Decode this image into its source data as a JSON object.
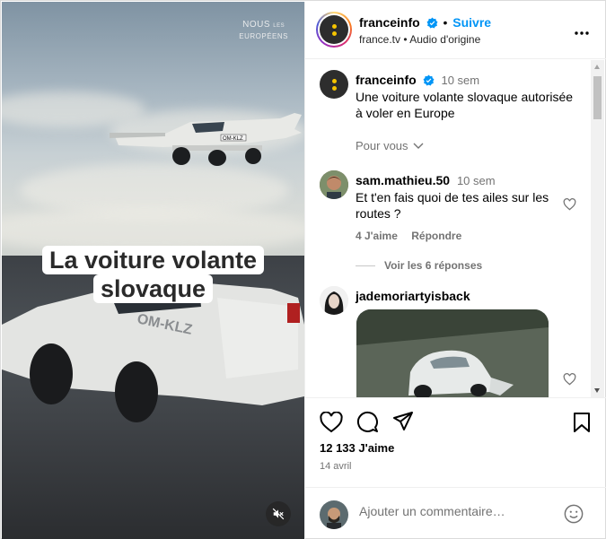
{
  "media": {
    "brand_line1": "NOUS",
    "brand_line1_small": "LES",
    "brand_line2": "EUROPÉENS",
    "caption_line1": "La voiture volante",
    "caption_line2": "slovaque",
    "plate_text": "OM-KLZ",
    "mute_icon": "speaker-muted-icon"
  },
  "header": {
    "username": "franceinfo",
    "follow_label": "Suivre",
    "separator": "•",
    "sub_source": "france.tv",
    "sub_audio": "Audio d'origine",
    "more_icon": "more-options-icon"
  },
  "caption_post": {
    "username": "franceinfo",
    "time": "10 sem",
    "text": "Une voiture volante slovaque autorisée à voler en Europe",
    "pour_vous": "Pour vous"
  },
  "comments": [
    {
      "username": "sam.mathieu.50",
      "time": "10 sem",
      "text": "Et t'en fais quoi de tes ailes sur les routes ?",
      "likes": "4 J'aime",
      "reply": "Répondre",
      "view_replies": "Voir les 6 réponses"
    },
    {
      "username": "jademoriartyisback",
      "time": "",
      "text": ""
    }
  ],
  "actions": {
    "likes": "12 133 J'aime",
    "date": "14 avril"
  },
  "add_comment": {
    "placeholder": "Ajouter un commentaire…"
  },
  "colors": {
    "accent": "#0095f6",
    "secondary_text": "#737373",
    "brand_dot": "#f5c400",
    "brand_bg": "#2d2d2d"
  }
}
